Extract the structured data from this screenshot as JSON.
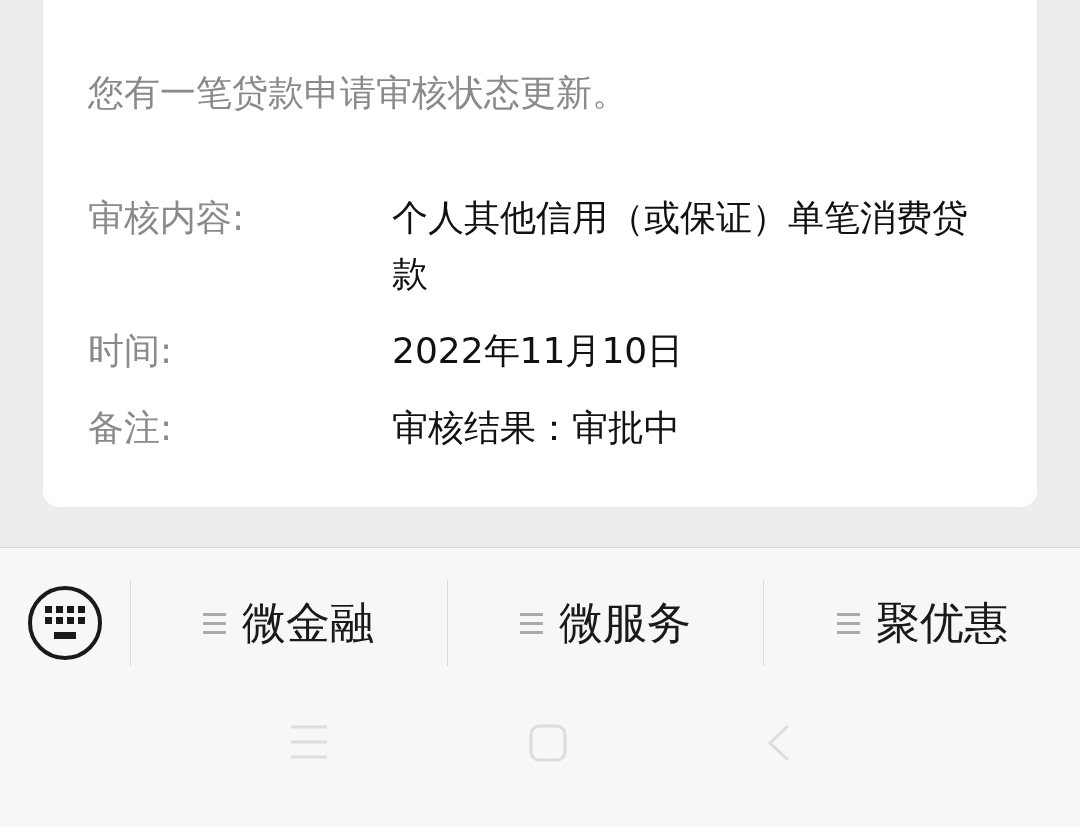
{
  "card": {
    "intro": "您有一笔贷款申请审核状态更新。",
    "fields": [
      {
        "label": "审核内容:",
        "value": "个人其他信用（或保证）单笔消费贷款"
      },
      {
        "label": "时间:",
        "value": "2022年11月10日"
      },
      {
        "label": "备注:",
        "value": "审核结果：审批中"
      }
    ]
  },
  "menu": {
    "items": [
      "微金融",
      "微服务",
      "聚优惠"
    ]
  }
}
